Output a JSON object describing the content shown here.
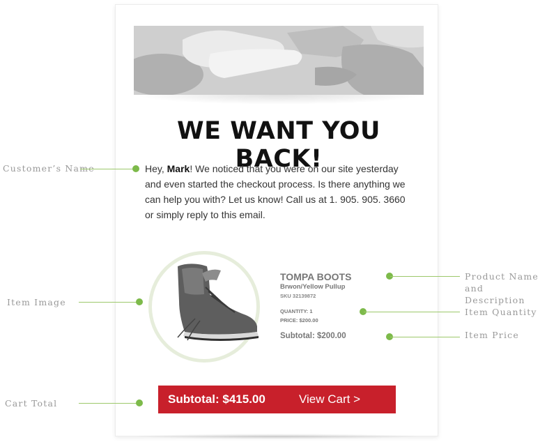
{
  "email": {
    "headline": "WE WANT YOU BACK!",
    "greeting": "Hey, ",
    "customer_name": "Mark",
    "message_rest": "! We noticed that you were on our site yesterday and even started the checkout process. Is there anything we can help you with? Let us know! Call us at 1. 905. 905. 3660 or simply reply to this email."
  },
  "product": {
    "name": "TOMPA BOOTS",
    "description": "Brwon/Yellow Pullup",
    "sku": "SKU 32139872",
    "quantity": "QUANTITY: 1",
    "price": "PRICE: $200.00",
    "subtotal": "Subtotal: $200.00"
  },
  "cart": {
    "total": "Subtotal: $415.00",
    "link": "View Cart >"
  },
  "annotations": {
    "customer_name": "Customer’s Name",
    "item_image": "Item Image",
    "cart_total": "Cart Total",
    "product_name_line1": "Product Name",
    "product_name_line2": "and Description",
    "item_quantity": "Item Quantity",
    "item_price": "Item Price"
  },
  "colors": {
    "accent_red": "#c8202b",
    "annotation_green": "#7dba4a"
  }
}
